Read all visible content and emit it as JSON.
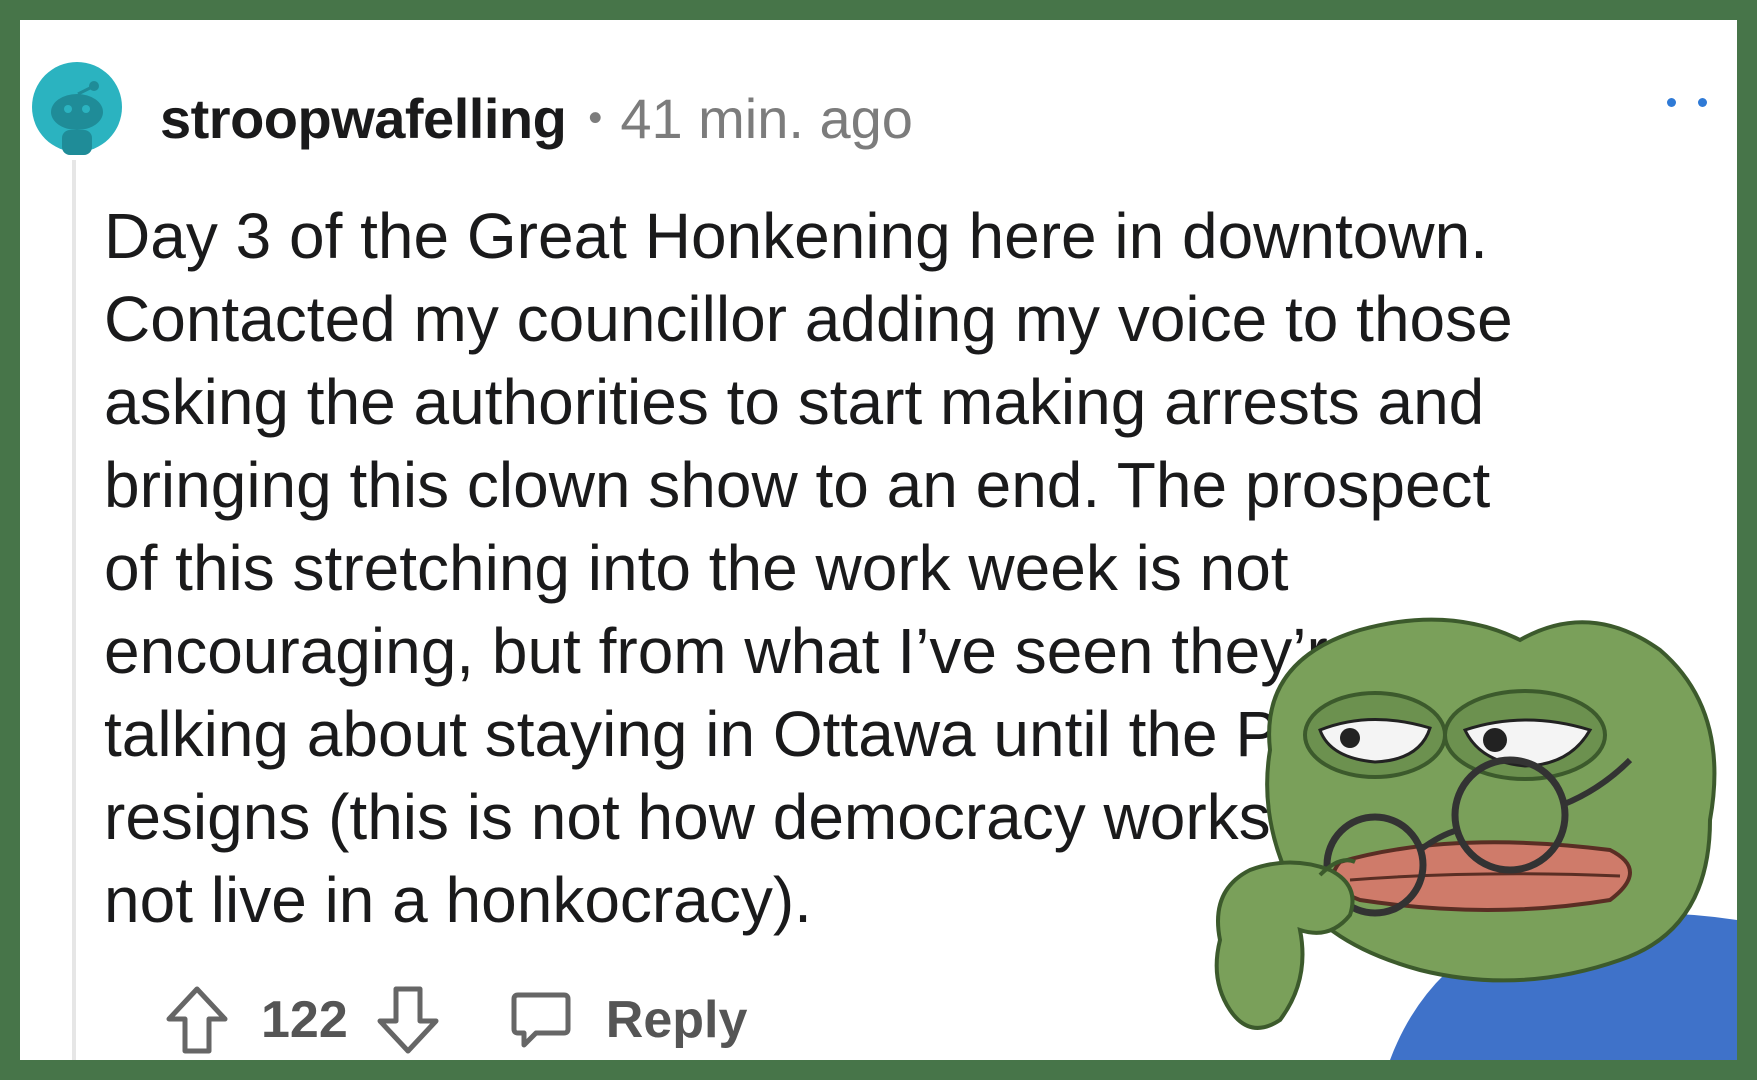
{
  "comment": {
    "username": "stroopwafelling",
    "separator": "•",
    "timestamp": "41 min. ago",
    "body_lines": [
      "Day 3 of the Great Honkening here in downtown.",
      "Contacted my councillor adding my voice to those",
      "asking the authorities to start making arrests and",
      "bringing this clown show to an end. The prospect",
      "of this stretching into the work week is not",
      "encouraging, but from what I’ve seen they’re",
      "talking about staying in Ottawa until the PM",
      "resigns (this is not how democracy works, we do",
      "not live in a honkocracy)."
    ],
    "vote_count": "122",
    "reply_label": "Reply"
  },
  "icons": {
    "avatar": "reddit-snoo-avatar-icon",
    "more": "more-options-icon",
    "upvote": "upvote-arrow-icon",
    "downvote": "downvote-arrow-icon",
    "reply": "comment-bubble-icon"
  },
  "colors": {
    "frame": "#477549",
    "card": "#ffffff",
    "avatar": "#2bb3c0",
    "text": "#1a1a1b",
    "meta": "#7c7c7c",
    "accent_dots": "#2f7ad6"
  }
}
